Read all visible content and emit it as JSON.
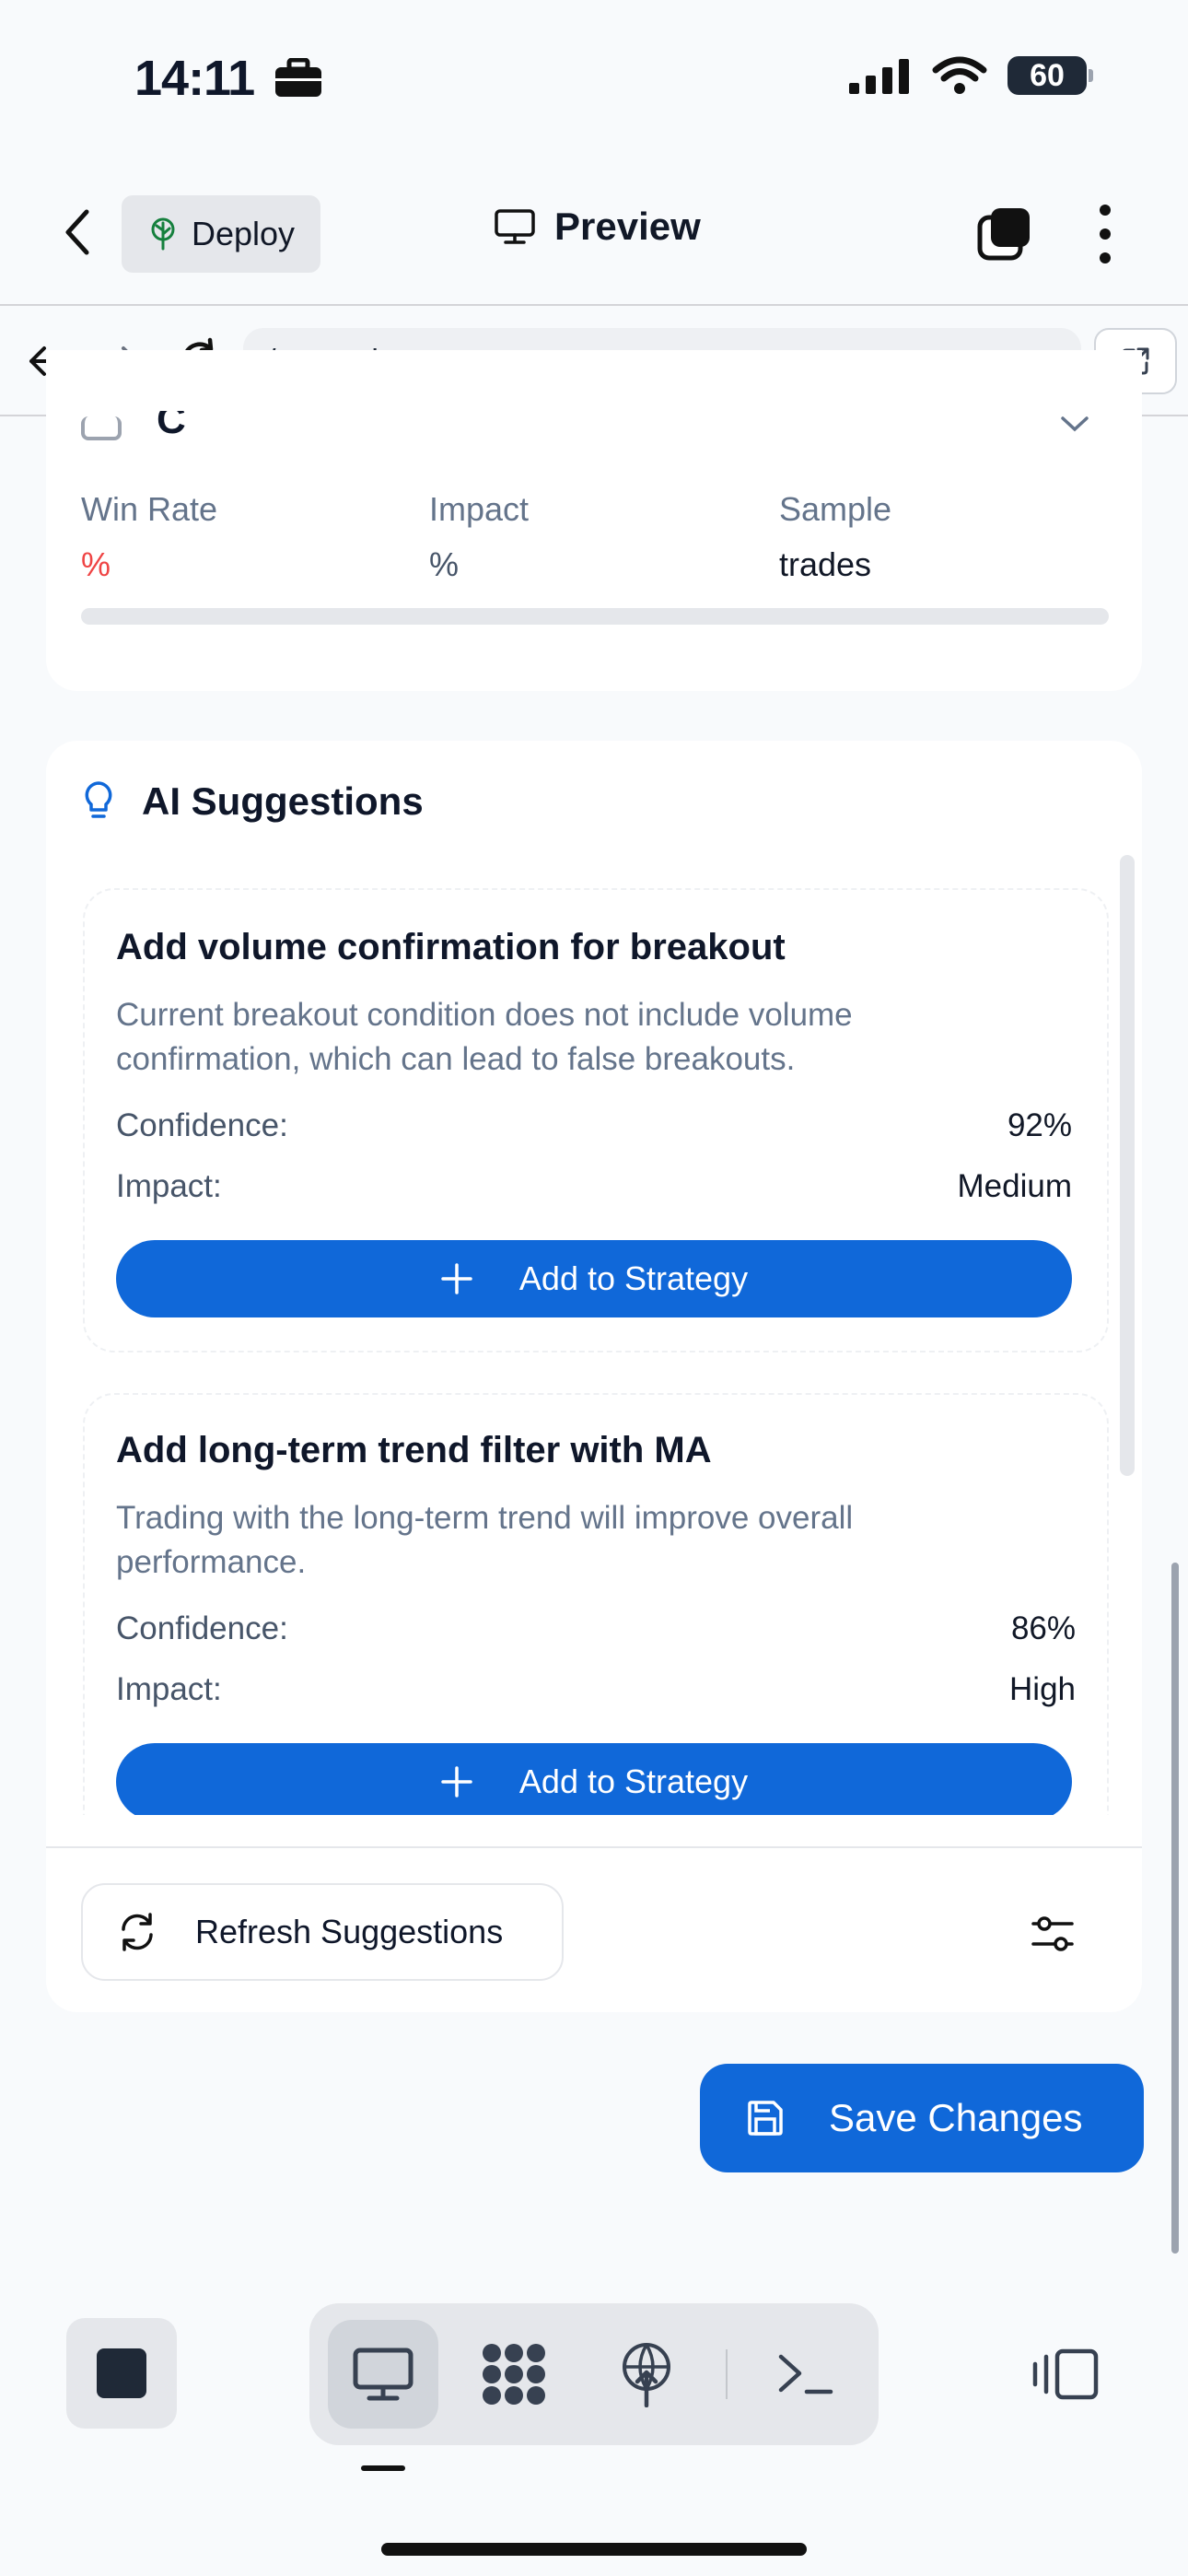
{
  "status": {
    "time": "14:11",
    "battery": "60"
  },
  "nav": {
    "deploy_label": "Deploy",
    "title": "Preview"
  },
  "url": {
    "path": "/strategies"
  },
  "metrics_card": {
    "heading_partial": "C",
    "win_rate_label": "Win Rate",
    "win_rate_value": "%",
    "impact_label": "Impact",
    "impact_value": "%",
    "sample_label": "Sample",
    "sample_value": "trades",
    "win_rate_color": "#ef4444"
  },
  "ai": {
    "title": "AI Suggestions",
    "suggestions": [
      {
        "title": "Add volume confirmation for breakout",
        "description": "Current breakout condition does not include volume confirmation, which can lead to false breakouts.",
        "confidence_label": "Confidence:",
        "confidence": "92%",
        "impact_label": "Impact:",
        "impact": "Medium",
        "button": "Add to Strategy"
      },
      {
        "title": "Add long-term trend filter with MA",
        "description": "Trading with the long-term trend will improve overall performance.",
        "confidence_label": "Confidence:",
        "confidence": "86%",
        "impact_label": "Impact:",
        "impact": "High",
        "button": "Add to Strategy"
      }
    ],
    "refresh_label": "Refresh Suggestions"
  },
  "save_label": "Save Changes",
  "colors": {
    "primary": "#1068d9",
    "accent_icon": "#1068d9"
  }
}
